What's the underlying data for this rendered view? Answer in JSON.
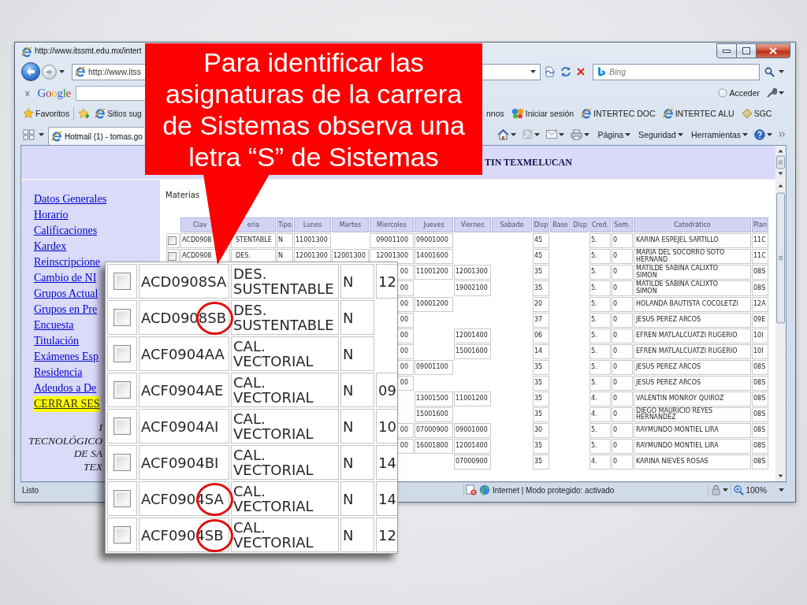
{
  "browser": {
    "title": "http://www.itssmt.edu.mx/intert",
    "address": "http://www.itss",
    "search": {
      "placeholder": "Bing"
    },
    "google_toolbar": {
      "close": "x",
      "logo": "Google",
      "sign_in": "Acceder"
    },
    "favorites_bar": {
      "favorites": "Favoritos",
      "items": [
        {
          "label": "Sitios sug",
          "kind": "site"
        },
        {
          "label": "nnos",
          "kind": "plain"
        },
        {
          "label": "Iniciar sesión",
          "kind": "messenger"
        },
        {
          "label": "INTERTEC DOC",
          "kind": "page"
        },
        {
          "label": "INTERTEC ALU",
          "kind": "page"
        },
        {
          "label": "SGC",
          "kind": "gallery"
        }
      ]
    },
    "tab": {
      "label": "Hotmail (1) - tomas.go"
    },
    "command_menus": [
      "Página",
      "Seguridad",
      "Herramientas"
    ],
    "status_bar": {
      "text": "Listo",
      "zone": "Internet | Modo protegido: activado",
      "zoom": "100%"
    }
  },
  "page": {
    "banner": "TIN TEXMELUCAN",
    "sidebar": {
      "links": [
        {
          "label": "Datos Generales",
          "highlighted": false
        },
        {
          "label": "Horario",
          "highlighted": false
        },
        {
          "label": "Calificaciones",
          "highlighted": false
        },
        {
          "label": "Kardex",
          "highlighted": false
        },
        {
          "label": "Reinscripcione",
          "highlighted": false
        },
        {
          "label": "Cambio de NI",
          "highlighted": false
        },
        {
          "label": "Grupos Actual",
          "highlighted": false
        },
        {
          "label": "Grupos en Pre",
          "highlighted": false
        },
        {
          "label": "Encuesta",
          "highlighted": false
        },
        {
          "label": "Titulación",
          "highlighted": false
        },
        {
          "label": "Exámenes Esp",
          "highlighted": false
        },
        {
          "label": "Residencia",
          "highlighted": false
        },
        {
          "label": "Adeudos a De",
          "highlighted": false
        },
        {
          "label": "CERRAR SES",
          "highlighted": true
        }
      ],
      "footer": [
        "I",
        "TECNOLÓGICO",
        "DE SA",
        "TEX"
      ]
    },
    "section_title": "Materias",
    "table": {
      "columns": [
        "Clav",
        "eria",
        "Tipo",
        "Lunes",
        "Martes",
        "Miercoles",
        "Jueves",
        "Viernes",
        "Sabado",
        "Disp",
        "Base",
        "Disp",
        "Cred.",
        "Sem.",
        "Catedrático",
        "Plan"
      ],
      "rows": [
        {
          "checked": false,
          "clave": "ACD0908",
          "materia": "STENTABLE",
          "tipo": "N",
          "lunes": "11001300",
          "miercoles": "09001100",
          "jueves": "09001000",
          "disp": "45",
          "cred": "5.",
          "sem": "0",
          "catedratico": "KARINA ESPEJEL SARTILLO",
          "plan": "11C"
        },
        {
          "checked": false,
          "clave": "ACD0908",
          "materia": "DES.",
          "tipo": "N",
          "lunes": "12001300",
          "martes": "12001300",
          "miercoles": "12001300",
          "jueves": "14001600",
          "disp": "45",
          "cred": "5.",
          "sem": "0",
          "catedratico": "MARIA DEL SOCORRO SOTO HERNAND",
          "plan": "11C"
        },
        {
          "miercoles": "00",
          "jueves": "11001200",
          "viernes": "12001300",
          "disp": "35",
          "cred": "5.",
          "sem": "0",
          "catedratico": "MATILDE SABINA CALIXTO SIMON",
          "plan": "08S"
        },
        {
          "miercoles": "00",
          "viernes": "19002100",
          "disp": "35",
          "cred": "5.",
          "sem": "0",
          "catedratico": "MATILDE SABINA CALIXTO SIMON",
          "plan": "08S"
        },
        {
          "miercoles": "00",
          "jueves": "10001200",
          "disp": "20",
          "cred": "5.",
          "sem": "0",
          "catedratico": "HOLANDA BAUTISTA COCOLETZI",
          "plan": "12A"
        },
        {
          "miercoles": "00",
          "disp": "37",
          "cred": "5.",
          "sem": "0",
          "catedratico": "JESUS PEREZ ARCOS",
          "plan": "09E"
        },
        {
          "miercoles": "00",
          "viernes": "12001400",
          "disp": "06",
          "cred": "5.",
          "sem": "0",
          "catedratico": "EFREN MATLALCUATZI RUGERIO",
          "plan": "10I"
        },
        {
          "miercoles": "00",
          "viernes": "15001600",
          "disp": "14",
          "cred": "5.",
          "sem": "0",
          "catedratico": "EFREN MATLALCUATZI RUGERIO",
          "plan": "10I"
        },
        {
          "miercoles": "00",
          "jueves": "09001100",
          "disp": "35",
          "cred": "5.",
          "sem": "0",
          "catedratico": "JESUS PEREZ ARCOS",
          "plan": "08S"
        },
        {
          "miercoles": "00",
          "disp": "35",
          "cred": "5.",
          "sem": "0",
          "catedratico": "JESUS PEREZ ARCOS",
          "plan": "08S"
        },
        {
          "jueves": "13001500",
          "viernes": "11001200",
          "disp": "35",
          "cred": "4.",
          "sem": "0",
          "catedratico": "VALENTIN MONROY QUIROZ",
          "plan": "08S"
        },
        {
          "jueves": "15001600",
          "disp": "35",
          "cred": "4.",
          "sem": "0",
          "catedratico": "DIEGO MAURICIO REYES HERNANDEZ",
          "plan": "08S"
        },
        {
          "miercoles": "00",
          "jueves": "07000900",
          "viernes": "09001000",
          "disp": "30",
          "cred": "5.",
          "sem": "0",
          "catedratico": "RAYMUNDO MONTIEL LIRA",
          "plan": "08S"
        },
        {
          "miercoles": "00",
          "jueves": "16001800",
          "viernes": "12001400",
          "disp": "35",
          "cred": "5.",
          "sem": "0",
          "catedratico": "RAYMUNDO MONTIEL LIRA",
          "plan": "08S"
        },
        {
          "viernes": "07000900",
          "disp": "35",
          "cred": "4.",
          "sem": "0",
          "catedratico": "KARINA NIEVES ROSAS",
          "plan": "08S"
        }
      ]
    }
  },
  "callout": {
    "text": "Para identificar las asignaturas de la carrera de Sistemas observa una letra “S” de Sistemas"
  },
  "inset": {
    "rows": [
      {
        "checked": false,
        "clave": "ACD0908SA",
        "materia": "DES. SUSTENTABLE",
        "tipo": "N",
        "lunes": "12",
        "circled": false
      },
      {
        "checked": false,
        "clave": "ACD0908SB",
        "materia": "DES. SUSTENTABLE",
        "tipo": "N",
        "circled": true
      },
      {
        "checked": false,
        "clave": "ACF0904AA",
        "materia": "CAL. VECTORIAL",
        "tipo": "N",
        "circled": false
      },
      {
        "checked": false,
        "clave": "ACF0904AE",
        "materia": "CAL. VECTORIAL",
        "tipo": "N",
        "lunes": "09",
        "circled": false
      },
      {
        "checked": false,
        "clave": "ACF0904AI",
        "materia": "CAL. VECTORIAL",
        "tipo": "N",
        "lunes": "10",
        "circled": false
      },
      {
        "checked": false,
        "clave": "ACF0904BI",
        "materia": "CAL. VECTORIAL",
        "tipo": "N",
        "lunes": "14",
        "circled": false
      },
      {
        "checked": false,
        "clave": "ACF0904SA",
        "materia": "CAL. VECTORIAL",
        "tipo": "N",
        "lunes": "14",
        "circled": true
      },
      {
        "checked": false,
        "clave": "ACF0904SB",
        "materia": "CAL. VECTORIAL",
        "tipo": "N",
        "lunes": "12",
        "circled": true
      }
    ]
  }
}
